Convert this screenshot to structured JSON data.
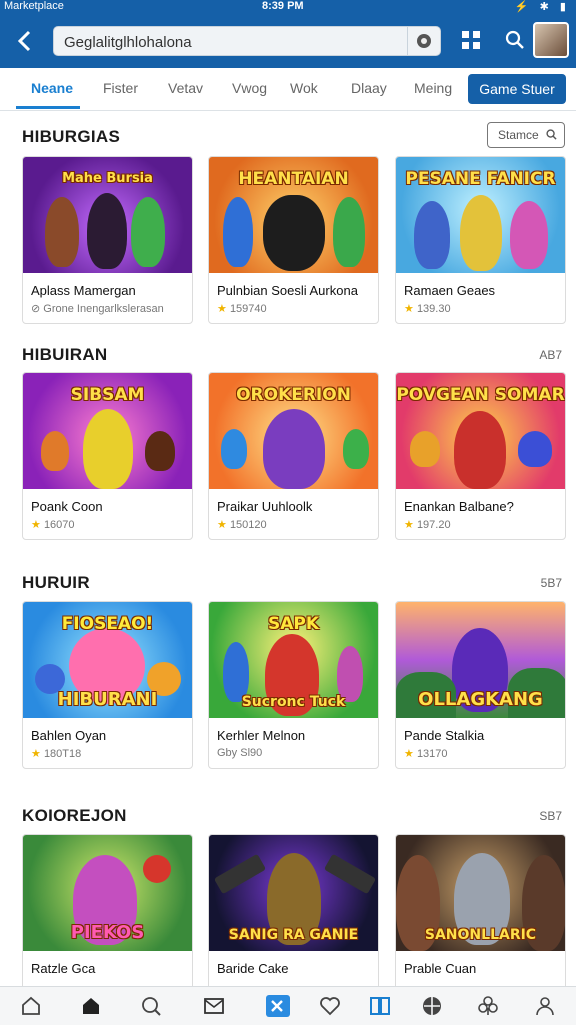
{
  "status_bar": {
    "left": "Marketplace",
    "time": "8:39 PM"
  },
  "search": {
    "value": "Geglalitglhlohalona"
  },
  "tabs": [
    {
      "label": "Neane",
      "active": true
    },
    {
      "label": "Fister"
    },
    {
      "label": "Vetav"
    },
    {
      "label": "Vwog"
    },
    {
      "label": "Wok"
    },
    {
      "label": "Dlaay"
    },
    {
      "label": "Meing"
    }
  ],
  "tab_button": "Game Stuer",
  "sections": [
    {
      "title": "HIBURGIAS",
      "action": "Stamce",
      "cards": [
        {
          "thumb_text": "Mahe Bursia",
          "name": "Aplass Mamergan",
          "meta": "Grone Inengarlkslerasan"
        },
        {
          "thumb_text": "HEANTAIAN",
          "name": "Pulnbian Soesli Aurkona",
          "meta": "159740"
        },
        {
          "thumb_text": "PESANE FANICR",
          "name": "Ramaen Geaes",
          "meta": "139.30"
        }
      ]
    },
    {
      "title": "HIBUIRAN",
      "action": "AB7",
      "cards": [
        {
          "thumb_text": "SIBSAM",
          "name": "Poank Coon",
          "meta": "16070"
        },
        {
          "thumb_text": "OROKERION",
          "name": "Praikar Uuhloolk",
          "meta": "150120"
        },
        {
          "thumb_text": "POVGEAN SOMAR",
          "name": "Enankan Balbane?",
          "meta": "197.20"
        }
      ]
    },
    {
      "title": "HURUIR",
      "action": "5B7",
      "cards": [
        {
          "thumb_text": "FIOSEAO!",
          "thumb_text2": "HIBURANI",
          "name": "Bahlen Oyan",
          "meta": "180T18"
        },
        {
          "thumb_text": "SAPK",
          "thumb_text2": "Sucronc Tuck",
          "name": "Kerhler Melnon",
          "meta": "Gby Sl90"
        },
        {
          "thumb_text": "OLLAGKANG",
          "name": "Pande Stalkia",
          "meta": "13170"
        }
      ]
    },
    {
      "title": "KOIOREJON",
      "action": "SB7",
      "cards": [
        {
          "thumb_text": "PIEKOS",
          "name": "Ratzle Gca"
        },
        {
          "thumb_text": "SANIG RA GANIE",
          "name": "Baride Cake"
        },
        {
          "thumb_text": "SANONLLARIC",
          "name": "Prable Cuan"
        }
      ]
    }
  ],
  "bottom_nav": [
    "home-outline",
    "home",
    "search",
    "mail",
    "close",
    "heart",
    "columns",
    "globe",
    "club",
    "person"
  ]
}
